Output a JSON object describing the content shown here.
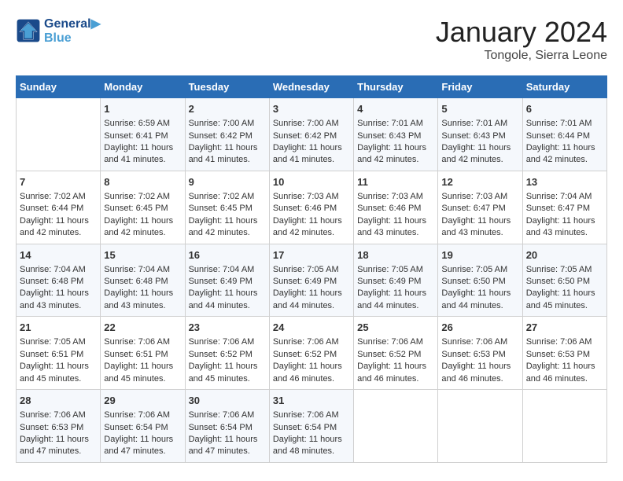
{
  "header": {
    "logo_line1": "General",
    "logo_line2": "Blue",
    "month_title": "January 2024",
    "subtitle": "Tongole, Sierra Leone"
  },
  "weekdays": [
    "Sunday",
    "Monday",
    "Tuesday",
    "Wednesday",
    "Thursday",
    "Friday",
    "Saturday"
  ],
  "weeks": [
    [
      {
        "day": "",
        "sunrise": "",
        "sunset": "",
        "daylight": ""
      },
      {
        "day": "1",
        "sunrise": "Sunrise: 6:59 AM",
        "sunset": "Sunset: 6:41 PM",
        "daylight": "Daylight: 11 hours and 41 minutes."
      },
      {
        "day": "2",
        "sunrise": "Sunrise: 7:00 AM",
        "sunset": "Sunset: 6:42 PM",
        "daylight": "Daylight: 11 hours and 41 minutes."
      },
      {
        "day": "3",
        "sunrise": "Sunrise: 7:00 AM",
        "sunset": "Sunset: 6:42 PM",
        "daylight": "Daylight: 11 hours and 41 minutes."
      },
      {
        "day": "4",
        "sunrise": "Sunrise: 7:01 AM",
        "sunset": "Sunset: 6:43 PM",
        "daylight": "Daylight: 11 hours and 42 minutes."
      },
      {
        "day": "5",
        "sunrise": "Sunrise: 7:01 AM",
        "sunset": "Sunset: 6:43 PM",
        "daylight": "Daylight: 11 hours and 42 minutes."
      },
      {
        "day": "6",
        "sunrise": "Sunrise: 7:01 AM",
        "sunset": "Sunset: 6:44 PM",
        "daylight": "Daylight: 11 hours and 42 minutes."
      }
    ],
    [
      {
        "day": "7",
        "sunrise": "Sunrise: 7:02 AM",
        "sunset": "Sunset: 6:44 PM",
        "daylight": "Daylight: 11 hours and 42 minutes."
      },
      {
        "day": "8",
        "sunrise": "Sunrise: 7:02 AM",
        "sunset": "Sunset: 6:45 PM",
        "daylight": "Daylight: 11 hours and 42 minutes."
      },
      {
        "day": "9",
        "sunrise": "Sunrise: 7:02 AM",
        "sunset": "Sunset: 6:45 PM",
        "daylight": "Daylight: 11 hours and 42 minutes."
      },
      {
        "day": "10",
        "sunrise": "Sunrise: 7:03 AM",
        "sunset": "Sunset: 6:46 PM",
        "daylight": "Daylight: 11 hours and 42 minutes."
      },
      {
        "day": "11",
        "sunrise": "Sunrise: 7:03 AM",
        "sunset": "Sunset: 6:46 PM",
        "daylight": "Daylight: 11 hours and 43 minutes."
      },
      {
        "day": "12",
        "sunrise": "Sunrise: 7:03 AM",
        "sunset": "Sunset: 6:47 PM",
        "daylight": "Daylight: 11 hours and 43 minutes."
      },
      {
        "day": "13",
        "sunrise": "Sunrise: 7:04 AM",
        "sunset": "Sunset: 6:47 PM",
        "daylight": "Daylight: 11 hours and 43 minutes."
      }
    ],
    [
      {
        "day": "14",
        "sunrise": "Sunrise: 7:04 AM",
        "sunset": "Sunset: 6:48 PM",
        "daylight": "Daylight: 11 hours and 43 minutes."
      },
      {
        "day": "15",
        "sunrise": "Sunrise: 7:04 AM",
        "sunset": "Sunset: 6:48 PM",
        "daylight": "Daylight: 11 hours and 43 minutes."
      },
      {
        "day": "16",
        "sunrise": "Sunrise: 7:04 AM",
        "sunset": "Sunset: 6:49 PM",
        "daylight": "Daylight: 11 hours and 44 minutes."
      },
      {
        "day": "17",
        "sunrise": "Sunrise: 7:05 AM",
        "sunset": "Sunset: 6:49 PM",
        "daylight": "Daylight: 11 hours and 44 minutes."
      },
      {
        "day": "18",
        "sunrise": "Sunrise: 7:05 AM",
        "sunset": "Sunset: 6:49 PM",
        "daylight": "Daylight: 11 hours and 44 minutes."
      },
      {
        "day": "19",
        "sunrise": "Sunrise: 7:05 AM",
        "sunset": "Sunset: 6:50 PM",
        "daylight": "Daylight: 11 hours and 44 minutes."
      },
      {
        "day": "20",
        "sunrise": "Sunrise: 7:05 AM",
        "sunset": "Sunset: 6:50 PM",
        "daylight": "Daylight: 11 hours and 45 minutes."
      }
    ],
    [
      {
        "day": "21",
        "sunrise": "Sunrise: 7:05 AM",
        "sunset": "Sunset: 6:51 PM",
        "daylight": "Daylight: 11 hours and 45 minutes."
      },
      {
        "day": "22",
        "sunrise": "Sunrise: 7:06 AM",
        "sunset": "Sunset: 6:51 PM",
        "daylight": "Daylight: 11 hours and 45 minutes."
      },
      {
        "day": "23",
        "sunrise": "Sunrise: 7:06 AM",
        "sunset": "Sunset: 6:52 PM",
        "daylight": "Daylight: 11 hours and 45 minutes."
      },
      {
        "day": "24",
        "sunrise": "Sunrise: 7:06 AM",
        "sunset": "Sunset: 6:52 PM",
        "daylight": "Daylight: 11 hours and 46 minutes."
      },
      {
        "day": "25",
        "sunrise": "Sunrise: 7:06 AM",
        "sunset": "Sunset: 6:52 PM",
        "daylight": "Daylight: 11 hours and 46 minutes."
      },
      {
        "day": "26",
        "sunrise": "Sunrise: 7:06 AM",
        "sunset": "Sunset: 6:53 PM",
        "daylight": "Daylight: 11 hours and 46 minutes."
      },
      {
        "day": "27",
        "sunrise": "Sunrise: 7:06 AM",
        "sunset": "Sunset: 6:53 PM",
        "daylight": "Daylight: 11 hours and 46 minutes."
      }
    ],
    [
      {
        "day": "28",
        "sunrise": "Sunrise: 7:06 AM",
        "sunset": "Sunset: 6:53 PM",
        "daylight": "Daylight: 11 hours and 47 minutes."
      },
      {
        "day": "29",
        "sunrise": "Sunrise: 7:06 AM",
        "sunset": "Sunset: 6:54 PM",
        "daylight": "Daylight: 11 hours and 47 minutes."
      },
      {
        "day": "30",
        "sunrise": "Sunrise: 7:06 AM",
        "sunset": "Sunset: 6:54 PM",
        "daylight": "Daylight: 11 hours and 47 minutes."
      },
      {
        "day": "31",
        "sunrise": "Sunrise: 7:06 AM",
        "sunset": "Sunset: 6:54 PM",
        "daylight": "Daylight: 11 hours and 48 minutes."
      },
      {
        "day": "",
        "sunrise": "",
        "sunset": "",
        "daylight": ""
      },
      {
        "day": "",
        "sunrise": "",
        "sunset": "",
        "daylight": ""
      },
      {
        "day": "",
        "sunrise": "",
        "sunset": "",
        "daylight": ""
      }
    ]
  ]
}
